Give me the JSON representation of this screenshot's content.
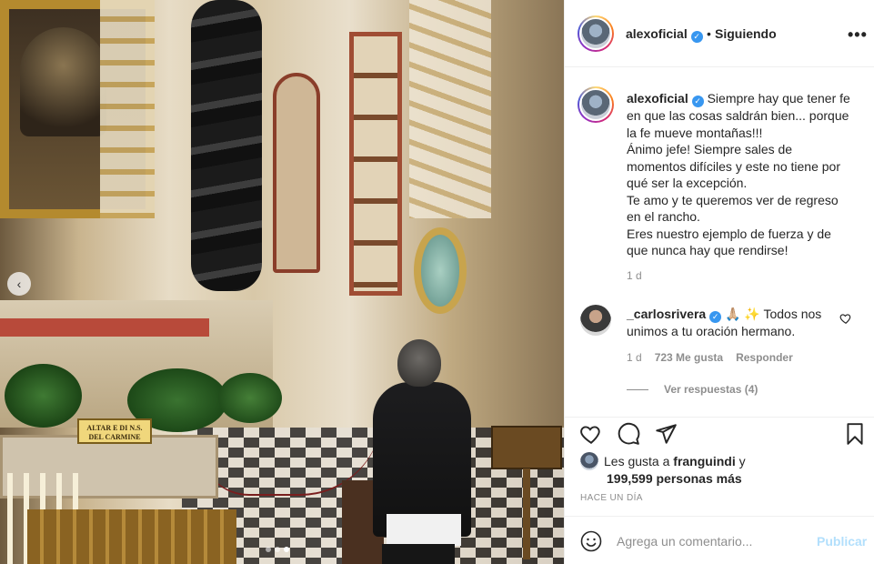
{
  "post": {
    "plate_text": "ALTAR E DI N.S. DEL CARMINE",
    "carousel": {
      "slides": 3,
      "active_slide": 3
    }
  },
  "header": {
    "username": "alexoficial",
    "separator": "•",
    "follow_label": "Siguiendo",
    "more_label": "•••"
  },
  "caption": {
    "username": "alexoficial",
    "lines": [
      "Siempre hay que tener fe",
      "en que las cosas saldrán bien... porque",
      "la fe mueve montañas!!!",
      "Ánimo jefe! Siempre sales de",
      "momentos difíciles y este no tiene por",
      "qué ser la excepción.",
      "Te amo y te queremos ver de regreso",
      "en el rancho.",
      "Eres nuestro ejemplo de fuerza y de",
      "que nunca hay que rendirse!"
    ],
    "time": "1 d"
  },
  "comment": {
    "username": "_carlosrivera",
    "emojis": "🙏🏼 ✨",
    "text_line1": "Todos nos",
    "text_line2": "unimos a tu oración hermano.",
    "time": "1 d",
    "likes": "723 Me gusta",
    "reply_label": "Responder",
    "view_replies": "Ver respuestas (4)"
  },
  "likes": {
    "prefix": "Les gusta a",
    "user": "franguindi",
    "conjunction": "y",
    "count": "199,599 personas más"
  },
  "posted_ago": "HACE UN DÍA",
  "composer": {
    "placeholder": "Agrega un comentario...",
    "publish_label": "Publicar"
  },
  "colors": {
    "verified": "#3897f0",
    "publish_disabled": "#b2dffc",
    "muted_text": "#8e8e8e",
    "border": "#efefef"
  }
}
